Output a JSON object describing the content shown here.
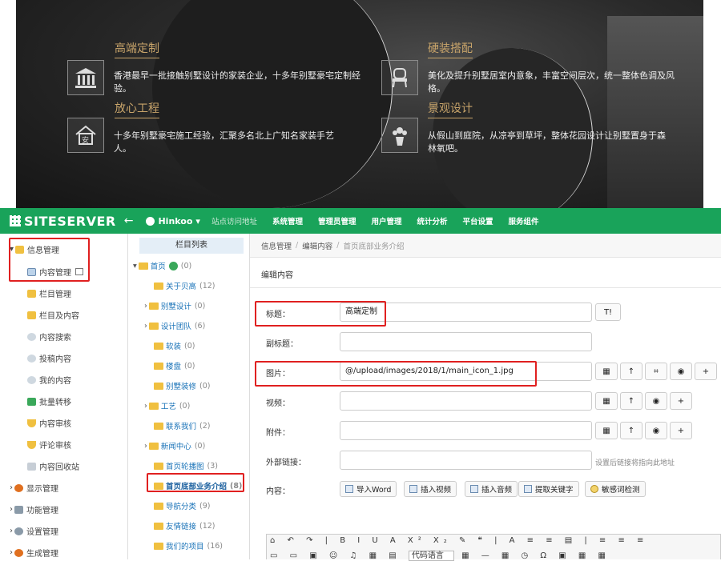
{
  "banner": {
    "features": [
      {
        "title": "高端定制",
        "icon": "building-icon",
        "text": "香港最早一批接触别墅设计的家装企业，十多年别墅豪宅定制经验。"
      },
      {
        "title": "硬装搭配",
        "icon": "chair-icon",
        "text": "美化及提升别墅居室内意象，丰富空间层次，统一整体色调及风格。"
      },
      {
        "title": "放心工程",
        "icon": "house-safe-icon",
        "text": "十多年别墅豪宅施工经验，汇聚多名北上广知名家装手艺人。"
      },
      {
        "title": "景观设计",
        "icon": "flower-vase-icon",
        "text": "从假山到庭院，从凉亭到草坪，整体花园设计让别墅置身于森林氧吧。"
      }
    ]
  },
  "topbar": {
    "logo": "SITESERVER",
    "back_icon": "←",
    "site_name": "Hinkoo",
    "nav": [
      "站点访问地址",
      "系统管理",
      "管理员管理",
      "用户管理",
      "统计分析",
      "平台设置",
      "服务组件"
    ]
  },
  "left_menu": [
    {
      "label": "信息管理",
      "icon": "folder-icon"
    },
    {
      "label": "内容管理",
      "icon": "content-icon"
    },
    {
      "label": "栏目管理",
      "icon": "folder-icon"
    },
    {
      "label": "栏目及内容",
      "icon": "folder-icon"
    },
    {
      "label": "内容搜索",
      "icon": "search-icon"
    },
    {
      "label": "投稿内容",
      "icon": "search-icon"
    },
    {
      "label": "我的内容",
      "icon": "search-icon"
    },
    {
      "label": "批量转移",
      "icon": "transfer-icon"
    },
    {
      "label": "内容审核",
      "icon": "shield-icon"
    },
    {
      "label": "评论审核",
      "icon": "shield-icon"
    },
    {
      "label": "内容回收站",
      "icon": "recycle-icon"
    },
    {
      "label": "显示管理",
      "icon": "display-icon"
    },
    {
      "label": "功能管理",
      "icon": "wrench-icon"
    },
    {
      "label": "设置管理",
      "icon": "gear-icon"
    },
    {
      "label": "生成管理",
      "icon": "build-icon"
    }
  ],
  "channel_tree": {
    "header": "栏目列表",
    "items": [
      {
        "label": "首页",
        "count": "(0)"
      },
      {
        "label": "关于贝高",
        "count": "(12)"
      },
      {
        "label": "别墅设计",
        "count": "(0)"
      },
      {
        "label": "设计团队",
        "count": "(6)"
      },
      {
        "label": "软装",
        "count": "(0)"
      },
      {
        "label": "楼盘",
        "count": "(0)"
      },
      {
        "label": "别墅装修",
        "count": "(0)"
      },
      {
        "label": "工艺",
        "count": "(0)"
      },
      {
        "label": "联系我们",
        "count": "(2)"
      },
      {
        "label": "新闻中心",
        "count": "(0)"
      },
      {
        "label": "首页轮播图",
        "count": "(3)"
      },
      {
        "label": "首页底部业务介绍",
        "count": "(8)"
      },
      {
        "label": "导航分类",
        "count": "(9)"
      },
      {
        "label": "友情链接",
        "count": "(12)"
      },
      {
        "label": "我们的项目",
        "count": "(16)"
      }
    ]
  },
  "breadcrumb": [
    "信息管理",
    "编辑内容",
    "首页底部业务介绍"
  ],
  "panel_title": "编辑内容",
  "form": {
    "title_label": "标题：",
    "title_value": "高端定制",
    "subtitle_label": "副标题：",
    "subtitle_value": "",
    "image_label": "图片：",
    "image_value": "@/upload/images/2018/1/main_icon_1.jpg",
    "video_label": "视频：",
    "attach_label": "附件：",
    "link_label": "外部链接：",
    "link_hint": "设置后链接将指向此地址",
    "content_label": "内容：",
    "tools": [
      "导入Word",
      "插入视频",
      "插入音频",
      "提取关键字",
      "敏感词检测"
    ],
    "title_btn": "T!",
    "editor_lang": "代码语言"
  }
}
